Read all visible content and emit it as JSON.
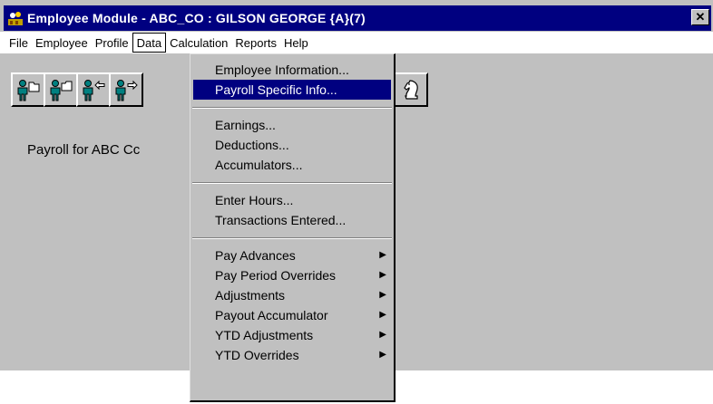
{
  "window": {
    "title": "Employee Module - ABC_CO : GILSON GEORGE {A}(7)",
    "close_glyph": "✕"
  },
  "menubar": {
    "items": [
      "File",
      "Employee",
      "Profile",
      "Data",
      "Calculation",
      "Reports",
      "Help"
    ],
    "open_item": "Data"
  },
  "toolbar": {
    "icons": [
      "employee-open-icon",
      "employee-save-icon",
      "employee-prev-icon",
      "employee-next-icon",
      "chess-knight-icon"
    ]
  },
  "main": {
    "payroll_label": "Payroll for ABC Cc"
  },
  "data_menu": {
    "group1": [
      "Employee Information...",
      "Payroll Specific Info..."
    ],
    "group2": [
      "Earnings...",
      "Deductions...",
      "Accumulators..."
    ],
    "group3": [
      "Enter Hours...",
      "Transactions Entered..."
    ],
    "group4": [
      "Pay Advances",
      "Pay Period Overrides",
      "Adjustments",
      "Payout Accumulator",
      "YTD Adjustments",
      "YTD Overrides"
    ],
    "highlighted": "Payroll Specific Info...",
    "submenu_arrow": "▶"
  },
  "colors": {
    "titlebar": "#000080",
    "highlight": "#000080",
    "window_bg": "#c0c0c0",
    "icon_teal": "#008080"
  }
}
